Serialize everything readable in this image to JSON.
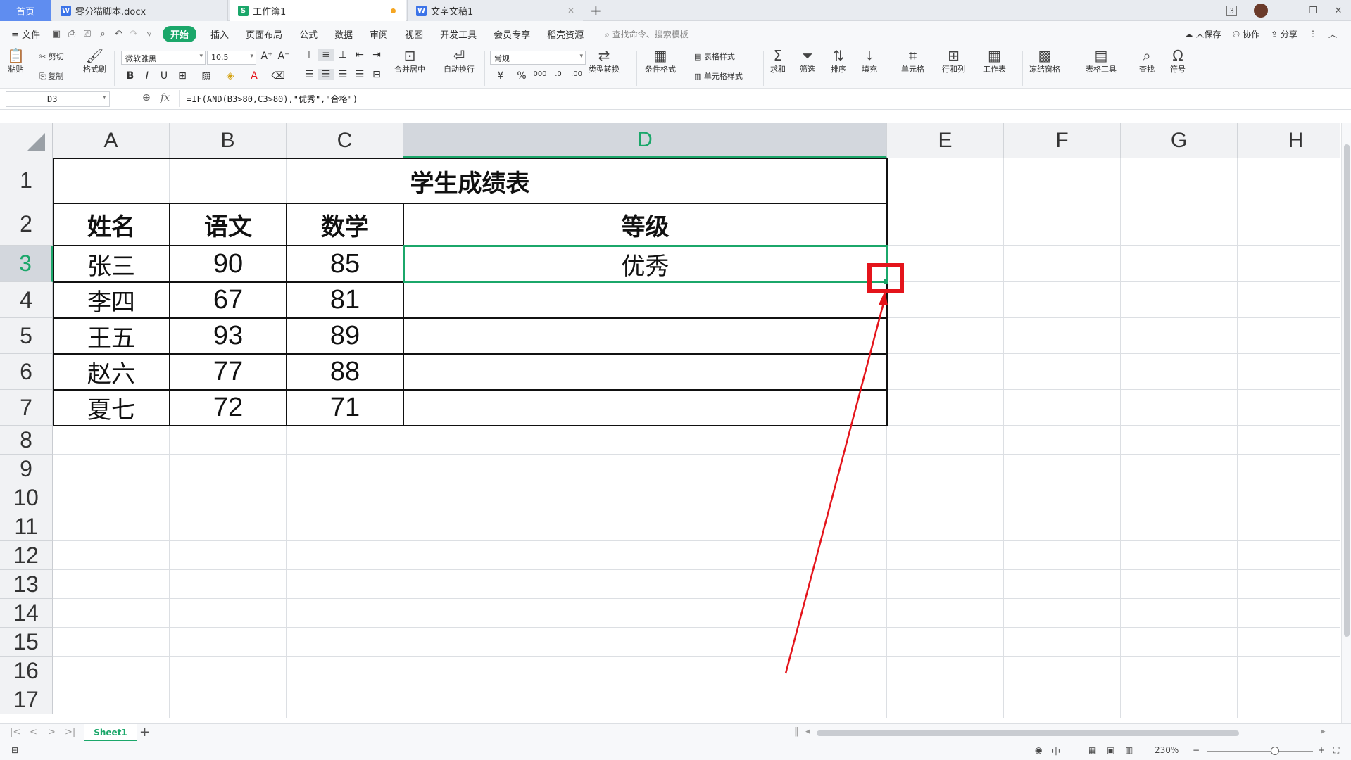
{
  "tabs": {
    "home": "首页",
    "doc": "零分猫脚本.docx",
    "sheet": "工作簿1",
    "doc2": "文字文稿1",
    "new_tab": "+"
  },
  "window": {
    "badge": "3"
  },
  "menubar": {
    "file": "≡ 文件",
    "items": [
      "开始",
      "插入",
      "页面布局",
      "公式",
      "数据",
      "审阅",
      "视图",
      "开发工具",
      "会员专享",
      "稻壳资源"
    ],
    "search": "查找命令、搜索模板",
    "unsaved": "未保存",
    "collab": "协作",
    "share": "分享"
  },
  "ribbon": {
    "paste": "粘贴",
    "cut": "剪切",
    "copy": "复制",
    "format_painter": "格式刷",
    "font_name": "微软雅黑",
    "font_size": "10.5",
    "merge_center": "合并居中",
    "wrap_text": "自动换行",
    "number_format": "常规",
    "type_convert": "类型转换",
    "cond_format": "条件格式",
    "table_style": "表格样式",
    "cell_style": "单元格样式",
    "sum": "求和",
    "filter": "筛选",
    "sort": "排序",
    "fill": "填充",
    "cell": "单元格",
    "rowcol": "行和列",
    "worksheet": "工作表",
    "freeze": "冻结窗格",
    "table_tools": "表格工具",
    "find": "查找",
    "symbol": "符号"
  },
  "formula_bar": {
    "name_box": "D3",
    "fx": "fx",
    "formula": "=IF(AND(B3>80,C3>80),\"优秀\",\"合格\")"
  },
  "grid": {
    "columns": [
      "A",
      "B",
      "C",
      "D",
      "E",
      "F",
      "G",
      "H"
    ],
    "rows": [
      "1",
      "2",
      "3",
      "4",
      "5",
      "6",
      "7",
      "8",
      "9",
      "10",
      "11",
      "12",
      "13",
      "14",
      "15",
      "16",
      "17"
    ],
    "selected_column": "D",
    "selected_row": "3"
  },
  "table": {
    "title": "学生成绩表",
    "headers": [
      "姓名",
      "语文",
      "数学",
      "等级"
    ],
    "rows": [
      [
        "张三",
        "90",
        "85",
        "优秀"
      ],
      [
        "李四",
        "67",
        "81",
        ""
      ],
      [
        "王五",
        "93",
        "89",
        ""
      ],
      [
        "赵六",
        "77",
        "88",
        ""
      ],
      [
        "夏七",
        "72",
        "71",
        ""
      ]
    ]
  },
  "sheets": {
    "active": "Sheet1",
    "add": "+"
  },
  "status": {
    "zoom": "230%"
  },
  "colors": {
    "accent": "#1ba76a",
    "annotation": "#e4141b",
    "home_tab": "#5f8df0"
  }
}
